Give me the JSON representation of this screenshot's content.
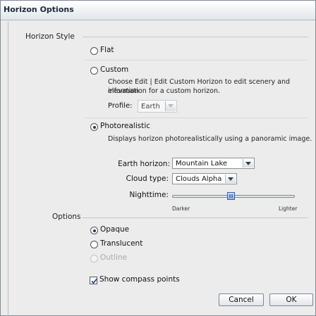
{
  "window": {
    "title": "Horizon Options"
  },
  "horizon_style": {
    "group_label": "Horizon Style",
    "flat_label": "Flat",
    "custom_label": "Custom",
    "custom_description_line1": "Choose Edit | Edit Custom Horizon to edit scenery and elevation",
    "custom_description_line2": "information for a custom horizon.",
    "profile_label": "Profile:",
    "profile_value": "Earth",
    "photorealistic_label": "Photorealistic",
    "photorealistic_description": "Displays horizon photorealistically using a panoramic image.",
    "selected": "Photorealistic"
  },
  "photorealistic_settings": {
    "earth_horizon_label": "Earth horizon:",
    "earth_horizon_value": "Mountain Lake",
    "cloud_type_label": "Cloud type:",
    "cloud_type_value": "Clouds Alpha",
    "nighttime_label": "Nighttime:",
    "nighttime_level": 0.48,
    "darker_label": "Darker",
    "lighter_label": "Lighter"
  },
  "options": {
    "group_label": "Options",
    "opaque_label": "Opaque",
    "translucent_label": "Translucent",
    "outline_label": "Outline",
    "selected": "Opaque",
    "show_compass_label": "Show compass points",
    "show_compass_checked": true
  },
  "buttons": {
    "cancel": "Cancel",
    "ok": "OK"
  }
}
